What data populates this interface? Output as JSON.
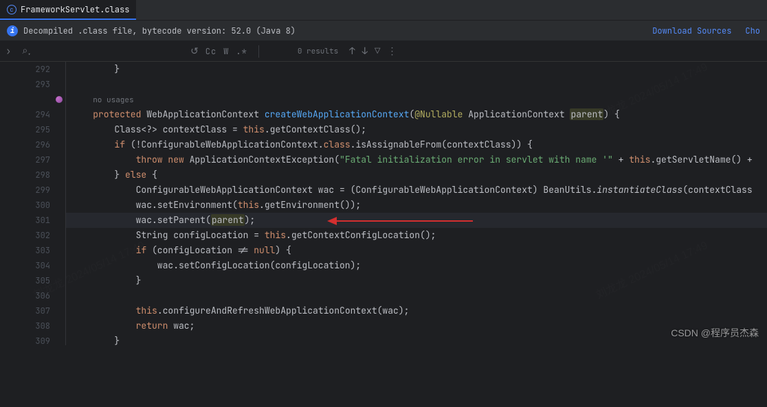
{
  "tab": {
    "label": "FrameworkServlet.class"
  },
  "info": {
    "text": "Decompiled .class file, bytecode version: 52.0 (Java 8)"
  },
  "links": {
    "download": "Download Sources",
    "choose": "Cho"
  },
  "toolbar": {
    "results": "0 results",
    "cc": "Cc",
    "w": "W",
    "regex": ".*"
  },
  "lines": {
    "l292": "292",
    "l293": "293",
    "l294": "294",
    "l295": "295",
    "l296": "296",
    "l297": "297",
    "l298": "298",
    "l299": "299",
    "l300": "300",
    "l301": "301",
    "l302": "302",
    "l303": "303",
    "l304": "304",
    "l305": "305",
    "l306": "306",
    "l307": "307",
    "l308": "308",
    "l309": "309"
  },
  "code": {
    "hint": "no usages",
    "c292": "        }",
    "c293": "",
    "c294_1": "    protected",
    "c294_2": " WebApplicationContext ",
    "c294_3": "createWebApplicationContext",
    "c294_4": "(",
    "c294_5": "@Nullable",
    "c294_6": " ApplicationContext ",
    "c294_7": "parent",
    "c294_8": ") {",
    "c295_1": "        Class<?> contextClass = ",
    "c295_2": "this",
    "c295_3": ".getContextClass();",
    "c296_1": "        if",
    "c296_2": " (!ConfigurableWebApplicationContext.",
    "c296_3": "class",
    "c296_4": ".isAssignableFrom(contextClass)) {",
    "c297_1": "            throw new",
    "c297_2": " ApplicationContextException(",
    "c297_3": "\"Fatal initialization error in servlet with name '\"",
    "c297_4": " + ",
    "c297_5": "this",
    "c297_6": ".getServletName() +",
    "c298_1": "        } ",
    "c298_2": "else",
    "c298_3": " {",
    "c299": "            ConfigurableWebApplicationContext wac = (ConfigurableWebApplicationContext) BeanUtils.",
    "c299_2": "instantiateClass",
    "c299_3": "(contextClass",
    "c300_1": "            wac.setEnvironment(",
    "c300_2": "this",
    "c300_3": ".getEnvironment());",
    "c301_1": "            wac.setParent(",
    "c301_2": "parent",
    "c301_3": ");",
    "c302_1": "            String configLocation = ",
    "c302_2": "this",
    "c302_3": ".getContextConfigLocation();",
    "c303_1": "            if",
    "c303_2": " (configLocation != ",
    "c303_3": "null",
    "c303_4": ") {",
    "c304": "                wac.setConfigLocation(configLocation);",
    "c305": "            }",
    "c306": "",
    "c307_1": "            this",
    "c307_2": ".configureAndRefreshWebApplicationContext(wac);",
    "c308_1": "            return",
    "c308_2": " wac;",
    "c309": "        }"
  },
  "watermark": "CSDN @程序员杰森",
  "wm_diag": "刘龙龙 2024/05/14 17:49"
}
